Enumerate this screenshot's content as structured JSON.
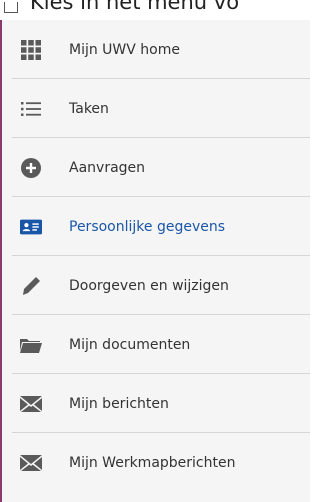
{
  "header": {
    "instruction": "Kies in het menu vo"
  },
  "menu": {
    "items": [
      {
        "label": "Mijn UWV home",
        "icon": "grid-icon"
      },
      {
        "label": "Taken",
        "icon": "list-icon"
      },
      {
        "label": "Aanvragen",
        "icon": "plus-circle-icon"
      },
      {
        "label": "Persoonlijke gegevens",
        "icon": "id-card-icon",
        "active": true
      },
      {
        "label": "Doorgeven en wijzigen",
        "icon": "pencil-icon"
      },
      {
        "label": "Mijn documenten",
        "icon": "folder-icon"
      },
      {
        "label": "Mijn berichten",
        "icon": "envelope-icon"
      },
      {
        "label": "Mijn Werkmapberichten",
        "icon": "envelope-icon"
      }
    ]
  },
  "colors": {
    "icon": "#5a5a5a",
    "active": "#1a56a8",
    "text": "#333333",
    "border_accent": "#8a3a6a"
  }
}
